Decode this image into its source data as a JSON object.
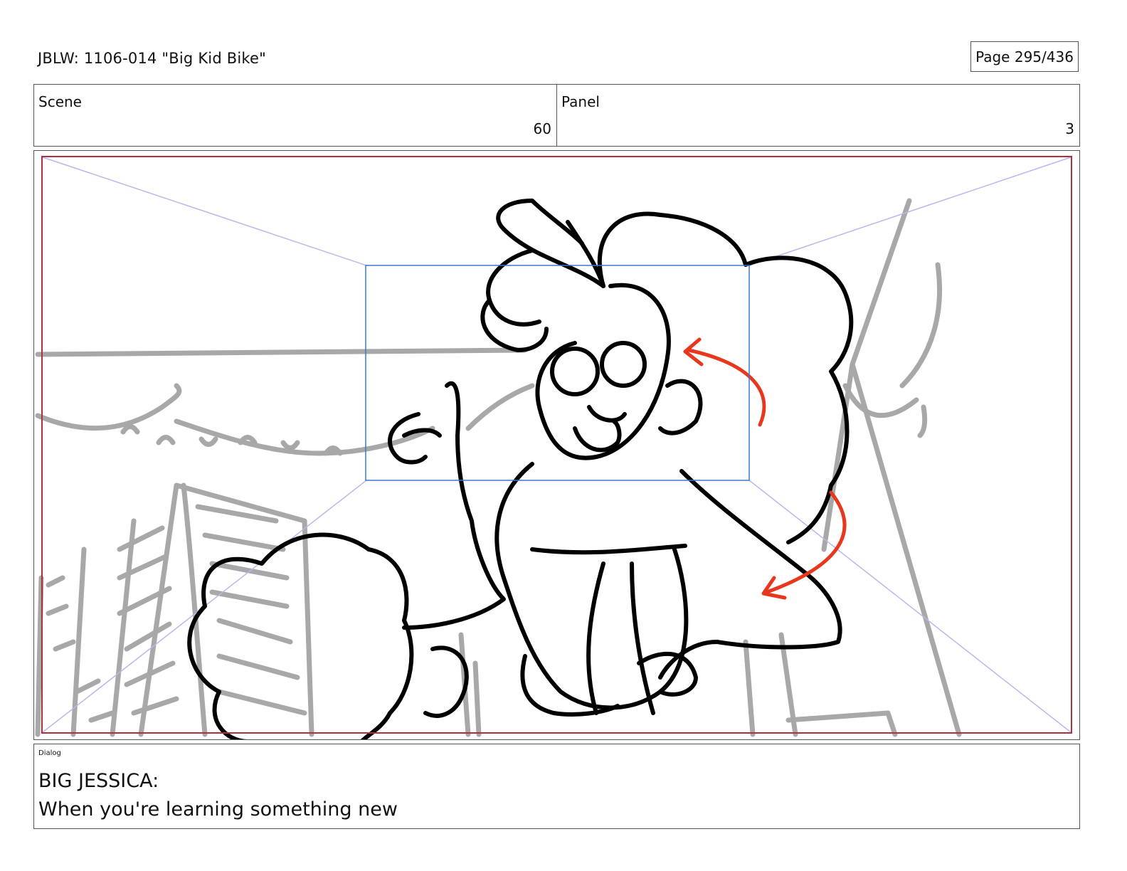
{
  "header": {
    "title": "JBLW: 1106-014 \"Big Kid Bike\"",
    "page": "Page 295/436"
  },
  "meta": {
    "scene_label": "Scene",
    "scene_value": "60",
    "panel_label": "Panel",
    "panel_value": "3"
  },
  "dialog": {
    "label": "Dialog",
    "speaker": "BIG JESSICA:",
    "line": "When you're learning something new"
  },
  "colors": {
    "frame_safe_area": "#b03040",
    "camera_box": "#3a78c8",
    "perspective_lines": "#b8b8ee",
    "motion_arrows": "#e8371c",
    "background_sketch": "#a8a8a8",
    "character_lines": "#000000"
  }
}
